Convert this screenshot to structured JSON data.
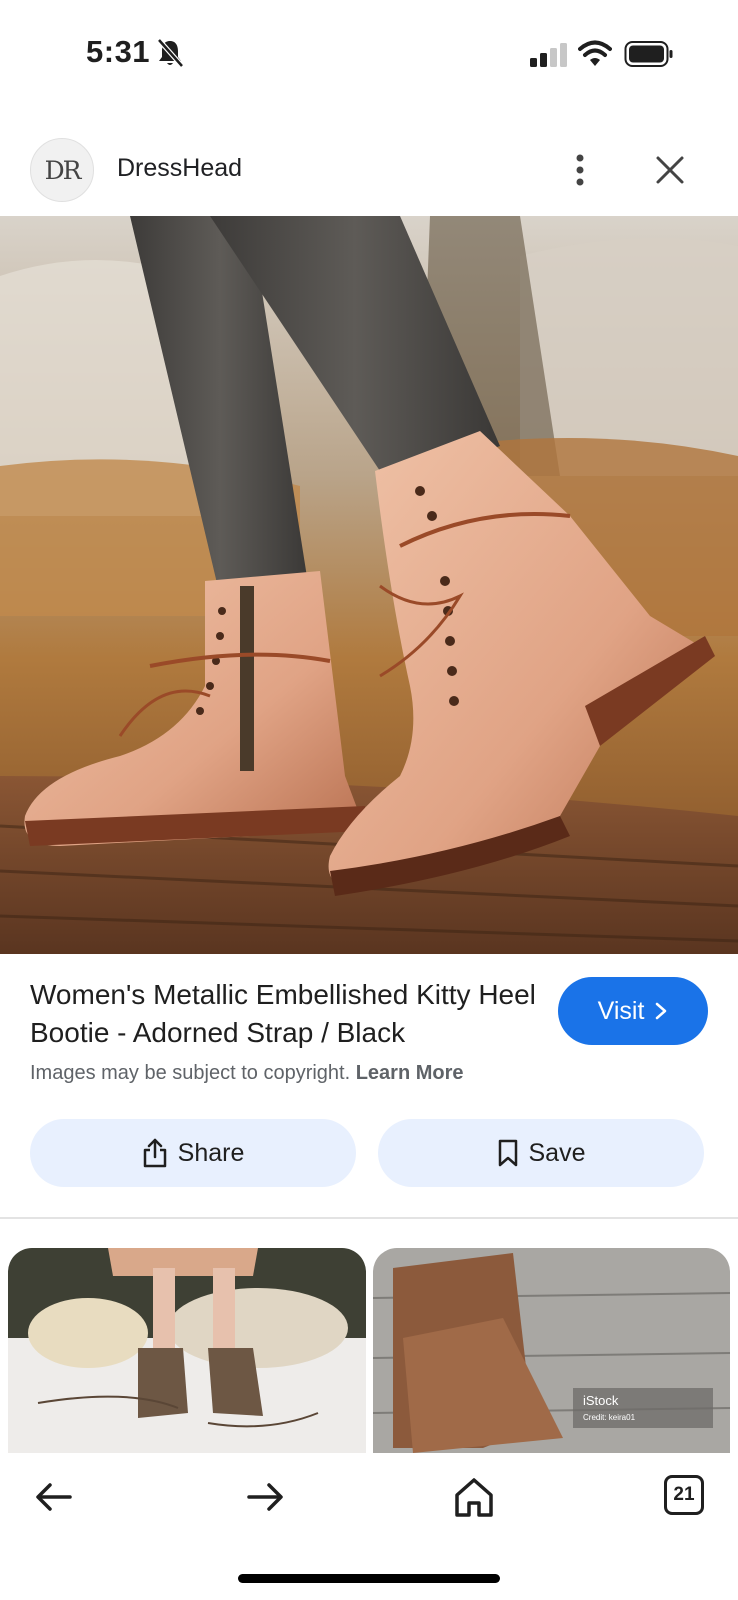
{
  "status_bar": {
    "time": "5:31"
  },
  "source": {
    "logo_text": "DR",
    "name": "DressHead"
  },
  "product": {
    "title": "Women's Metallic Embellished Kitty Heel Bootie - Adorned Strap / Black",
    "visit_label": "Visit",
    "copyright_text": "Images may be subject to copyright.",
    "learn_more_label": "Learn More"
  },
  "actions": {
    "share_label": "Share",
    "save_label": "Save"
  },
  "related": {
    "watermark_brand": "iStock",
    "watermark_credit": "Credit: keira01"
  },
  "bottom_nav": {
    "tab_count": "21"
  },
  "colors": {
    "accent": "#1a73e8",
    "action_bg": "#e8f0fe"
  }
}
